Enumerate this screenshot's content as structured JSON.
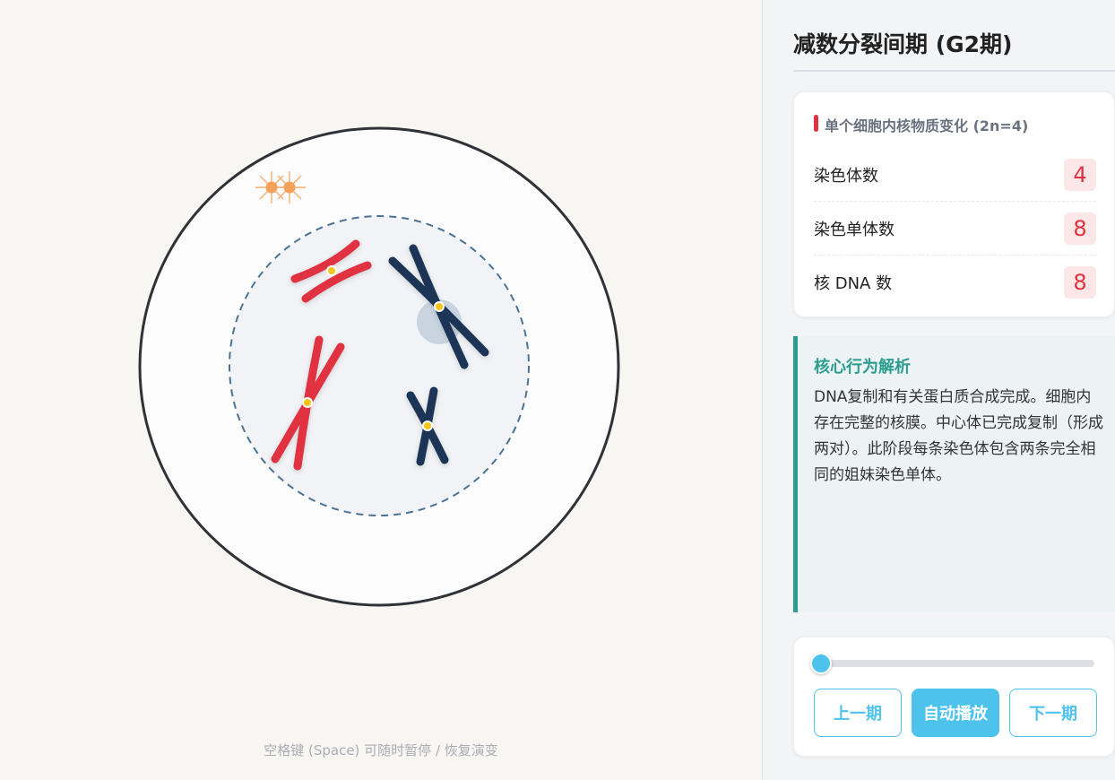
{
  "phase": {
    "title": "减数分裂间期 (G2期)"
  },
  "counts": {
    "header": "单个细胞内核物质变化 (2n=4)",
    "rows": [
      {
        "label": "染色体数",
        "value": "4"
      },
      {
        "label": "染色单体数",
        "value": "8"
      },
      {
        "label": "核 DNA 数",
        "value": "8"
      }
    ]
  },
  "analysis": {
    "title": "核心行为解析",
    "text": "DNA复制和有关蛋白质合成完成。细胞内存在完整的核膜。中心体已完成复制（形成两对）。此阶段每条染色体包含两条完全相同的姐妹染色单体。"
  },
  "controls": {
    "progress": 0,
    "prev_label": "上一期",
    "play_label": "自动播放",
    "next_label": "下一期"
  },
  "hint": "空格键 (Space) 可随时暂停 / 恢复演变",
  "colors": {
    "maternal": "#e0323f",
    "paternal": "#1c3557",
    "centrosome": "#f4a259",
    "accent": "#4dc3ec",
    "analysis": "#2a9d8f"
  }
}
